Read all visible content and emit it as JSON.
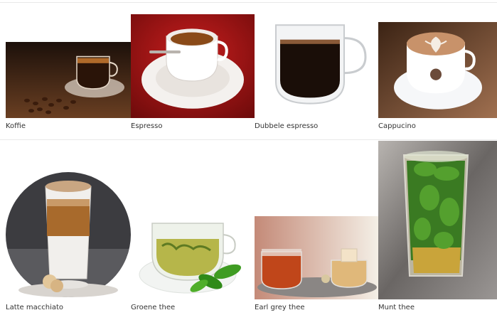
{
  "grid": {
    "items": [
      {
        "label": "Koffie",
        "image": "coffee-cup-with-beans"
      },
      {
        "label": "Espresso",
        "image": "espresso-cup-red-background"
      },
      {
        "label": "Dubbele espresso",
        "image": "double-wall-glass-espresso"
      },
      {
        "label": "Cappucino",
        "image": "cappuccino-latte-art"
      },
      {
        "label": "Latte macchiato",
        "image": "latte-macchiato-glass"
      },
      {
        "label": "Groene thee",
        "image": "green-tea-glass-cup"
      },
      {
        "label": "Earl grey thee",
        "image": "earl-grey-tea-glasses"
      },
      {
        "label": "Munt thee",
        "image": "mint-tea-glass"
      }
    ]
  }
}
